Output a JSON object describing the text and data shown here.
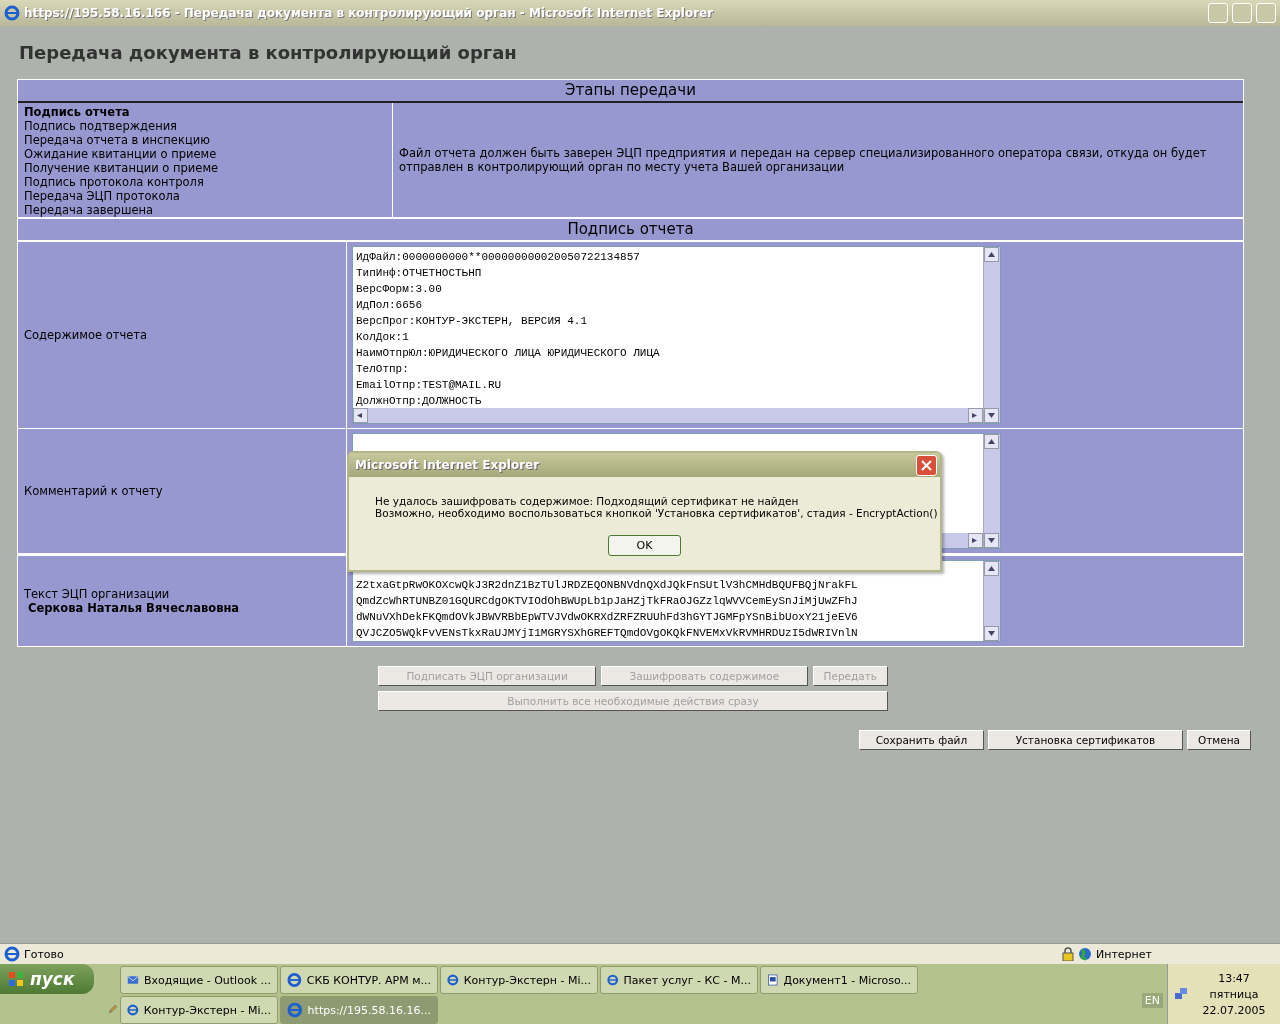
{
  "window": {
    "title": "https://195.58.16.166 - Передача документа в контролирующий орган - Microsoft Internet Explorer"
  },
  "page": {
    "heading": "Передача документа в контролирующий орган"
  },
  "stages": {
    "header": "Этапы передачи",
    "items": [
      {
        "label": "Подпись отчета",
        "selected": true
      },
      {
        "label": "Подпись подтверждения",
        "selected": false
      },
      {
        "label": "Передача отчета в инспекцию",
        "selected": false
      },
      {
        "label": "Ожидание квитанции о приеме",
        "selected": false
      },
      {
        "label": "Получение квитанции о приеме",
        "selected": false
      },
      {
        "label": "Подпись протокола контроля",
        "selected": false
      },
      {
        "label": "Передача ЭЦП протокола",
        "selected": false
      },
      {
        "label": "Передача завершена",
        "selected": false
      }
    ],
    "description": "Файл отчета должен быть заверен ЭЦП предприятия и передан на сервер специализированного оператора связи, откуда он будет отправлен в контролирующий орган по месту учета Вашей организации"
  },
  "section": {
    "header": "Подпись отчета",
    "report": {
      "label": "Содержимое отчета",
      "lines": [
        "ИдФайл:0000000000**000000000020050722134857",
        "ТипИнф:ОТЧЕТНОСТЬНП",
        "ВерсФорм:3.00",
        "ИдПол:6656",
        "ВерсПрог:КОНТУР-ЭКСТЕРН, ВЕРСИЯ 4.1",
        "КолДок:1",
        "НаимОтпрЮл:ЮРИДИЧЕСКОГО ЛИЦА ЮРИДИЧЕСКОГО ЛИЦА",
        "ТелОтпр:",
        "EmailОтпр:TEST@MAIL.RU",
        "ДолжнОтпр:ДОЛЖНОСТЬ"
      ]
    },
    "comment": {
      "label": "Комментарий к отчету"
    },
    "signature": {
      "label": "Текст ЭЦП организации",
      "name": "Серкова Наталья Вячеславовна",
      "lines": [
        "Z2txaGtpRwOKOXcwQkJ3R2dnZ1BzTUlJRDZEQONBNVdnQXdJQkFnSUtlV3hCMHdBQUFBQjNrakFL",
        "QmdZcWhRTUNBZ01GQURCdgOKTVIOdOhBWUpLb1pJaHZjTkFRaOJGZzlqWVVCemEySnJiMjUwZFhJ",
        "dWNuVXhDekFKQmdOVkJBWVRBbEpWTVJVdwOKRXdZRFZRUUhFd3hGYTJGMFpYSnBibUoxY21jeEV6",
        "QVJCZO5WQkFvVENsTkxRaUJMYjI1MGRYSXhGREFTQmdOVgOKQkFNVEMxVkRVMHRDUzI5dWRIVnlN"
      ]
    }
  },
  "action_buttons": [
    {
      "label": "Подписать ЭЦП организации",
      "disabled": true
    },
    {
      "label": "Зашифровать содержимое",
      "disabled": true
    },
    {
      "label": "Передать",
      "disabled": true
    },
    {
      "label": "Выполнить все необходимые действия сразу",
      "disabled": true
    }
  ],
  "footer_buttons": [
    {
      "label": "Сохранить файл"
    },
    {
      "label": "Установка сертификатов"
    },
    {
      "label": "Отмена"
    }
  ],
  "dialog": {
    "title": "Microsoft Internet Explorer",
    "lines": [
      "Не удалось зашифровать содержимое: Подходящий сертификат не найден",
      "Возможно, необходимо воспользоваться кнопкой 'Установка сертификатов', стадия - EncryptAction()"
    ],
    "button": "OK"
  },
  "status_bar": {
    "text": "Готово",
    "zone": "Интернет"
  },
  "taskbar": {
    "start": "пуск",
    "tasks": [
      {
        "label": "Входящие - Outlook ...",
        "kind": "outlook",
        "selected": false
      },
      {
        "label": "СКБ КОНТУР. АРМ м...",
        "kind": "ie",
        "selected": false
      },
      {
        "label": "Контур-Экстерн - Mi...",
        "kind": "ie",
        "selected": false
      },
      {
        "label": "Пакет услуг - КС - M...",
        "kind": "ie",
        "selected": false
      },
      {
        "label": "Документ1 - Microso...",
        "kind": "word",
        "selected": false
      },
      {
        "label": "Контур-Экстерн - Mi...",
        "kind": "ie",
        "selected": false
      },
      {
        "label": "https://195.58.16.16...",
        "kind": "ie",
        "selected": true
      }
    ],
    "tray": {
      "language": "EN",
      "time": "13:47",
      "day": "пятница",
      "date": "22.07.2005"
    }
  }
}
